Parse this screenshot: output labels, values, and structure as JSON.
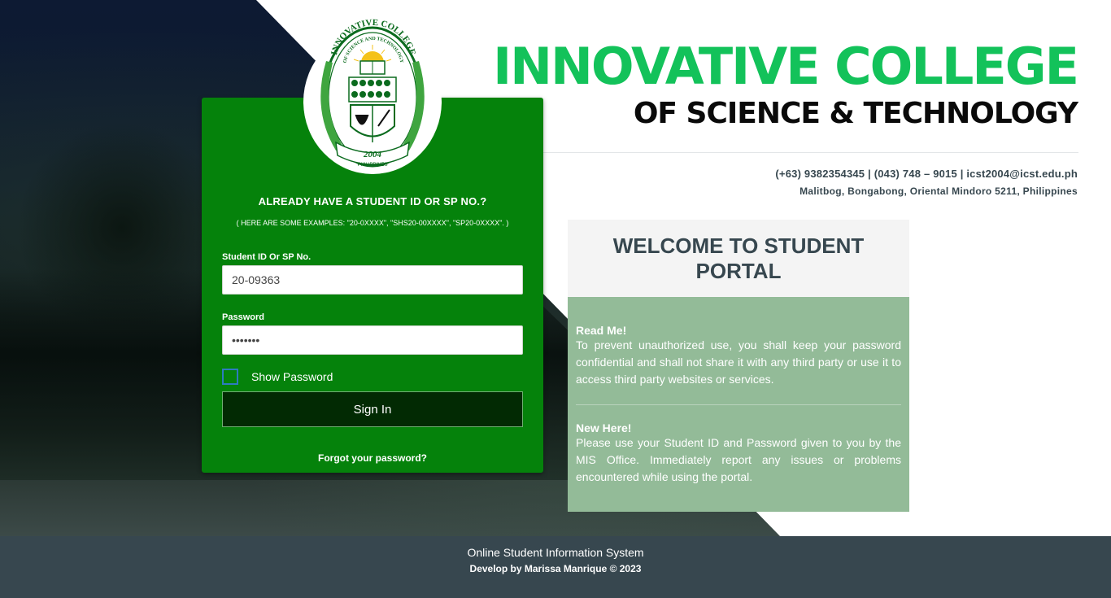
{
  "header": {
    "college_name": "INNOVATIVE COLLEGE",
    "college_subtitle": "OF SCIENCE & TECHNOLOGY",
    "contact": "(+63) 9382354345 | (043) 748 – 9015 | icst2004@icst.edu.ph",
    "address": "Malitbog, Bongabong, Oriental Mindoro 5211, Philippines"
  },
  "logo": {
    "top_text": "INNOVATIVE COLLEGE",
    "inner_text": "OF SCIENCE AND TECHNOLOGY",
    "year": "2004",
    "bottom_text": "PHILIPPINES"
  },
  "login": {
    "heading": "ALREADY HAVE A STUDENT ID OR SP NO.?",
    "examples": "( HERE ARE SOME EXAMPLES: \"20-0XXXX\", \"SHS20-00XXXX\", \"SP20-0XXXX\". )",
    "student_id_label": "Student ID Or SP No.",
    "student_id_value": "20-09363",
    "password_label": "Password",
    "password_value": "•••••••",
    "show_password_label": "Show Password",
    "sign_in_label": "Sign In",
    "forgot_label": "Forgot your password?"
  },
  "welcome": {
    "title": "WELCOME TO STUDENT PORTAL",
    "readme_title": "Read Me!",
    "readme_text": "To prevent unauthorized use, you shall keep your password confidential and shall not share it with any third party or use it to access third party websites or services.",
    "newhere_title": "New Here!",
    "newhere_text": "Please use your Student ID and Password given to you by the MIS Office. Immediately report any issues or problems encountered while using the portal."
  },
  "footer": {
    "line1": "Online Student Information System",
    "line2": "Develop by Marissa Manrique © 2023"
  },
  "colors": {
    "brand_green": "#13c25a",
    "card_green": "#05820b",
    "footer_bg": "#37474f",
    "panel_green": "#93bb98"
  }
}
